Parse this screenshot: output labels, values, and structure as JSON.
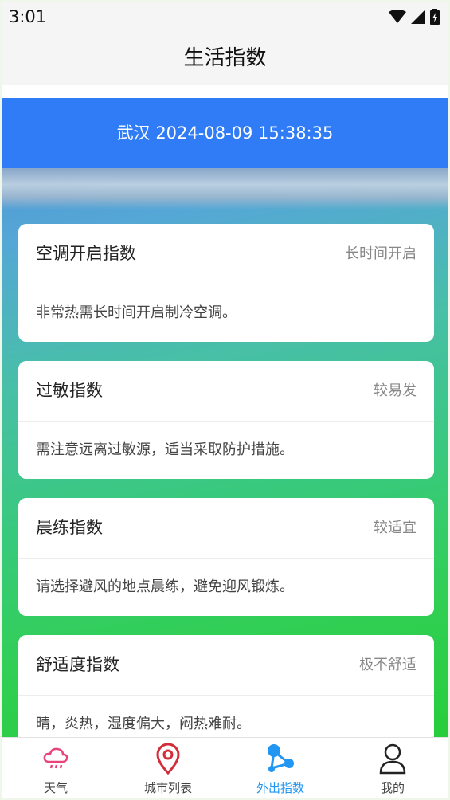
{
  "status": {
    "time": "3:01"
  },
  "title": "生活指数",
  "header": {
    "location_time": "武汉 2024-08-09 15:38:35"
  },
  "cards": [
    {
      "title": "空调开启指数",
      "level": "长时间开启",
      "desc": "非常热需长时间开启制冷空调。"
    },
    {
      "title": "过敏指数",
      "level": "较易发",
      "desc": "需注意远离过敏源，适当采取防护措施。"
    },
    {
      "title": "晨练指数",
      "level": "较适宜",
      "desc": "请选择避风的地点晨练，避免迎风锻炼。"
    },
    {
      "title": "舒适度指数",
      "level": "极不舒适",
      "desc": "晴，炎热，湿度偏大，闷热难耐。"
    }
  ],
  "nav": [
    {
      "label": "天气",
      "icon": "cloud-rain-icon"
    },
    {
      "label": "城市列表",
      "icon": "location-pin-icon"
    },
    {
      "label": "外出指数",
      "icon": "share-nodes-icon",
      "active": true
    },
    {
      "label": "我的",
      "icon": "user-icon"
    }
  ],
  "colors": {
    "banner": "#2f7cf6",
    "active_nav": "#2196f3",
    "weather_icon": "#e8437a",
    "city_icon": "#d32f3a"
  }
}
